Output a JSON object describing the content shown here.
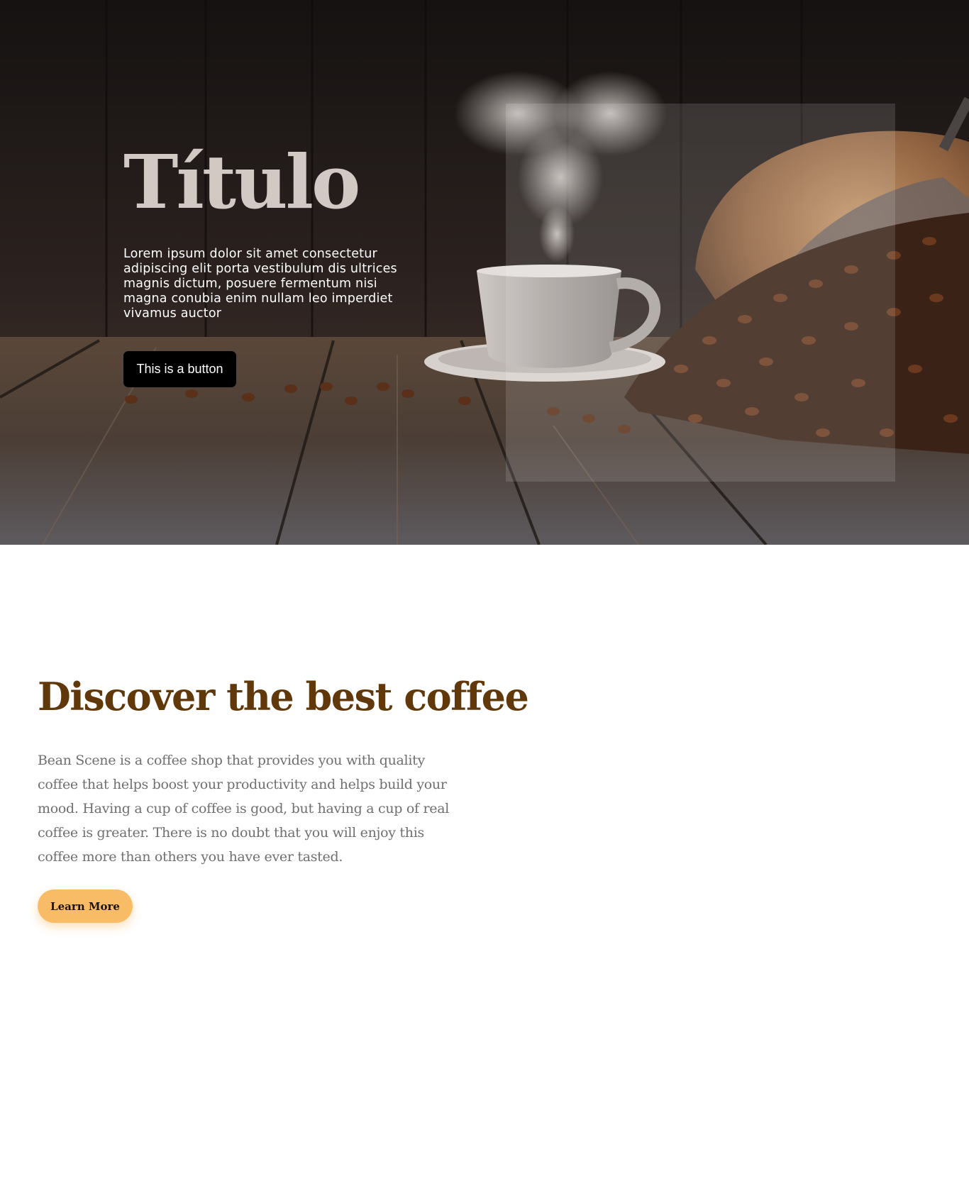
{
  "hero": {
    "title": "Título",
    "text": "Lorem ipsum dolor sit amet consectetur adipiscing elit porta vestibulum dis ultrices magnis dictum, posuere fermentum nisi magna conubia enim nullam leo imperdiet vivamus auctor",
    "button_label": "This is a button",
    "background_image": "coffee cup with heart-shaped steam, spilled coffee beans from burlap sack on wooden table"
  },
  "discover": {
    "title": "Discover the best coffee",
    "text": "Bean Scene is a coffee shop that provides you with quality coffee that helps boost your productivity and helps build your mood. Having a cup of coffee is good, but having a cup of real coffee is greater. There is no doubt that you will enjoy this coffee more than others you have ever tasted.",
    "button_label": "Learn More"
  },
  "colors": {
    "heading_brown": "#603809",
    "accent_orange": "#f8bc66",
    "hero_title": "#d2c8c4",
    "body_gray": "#6f6f6f"
  }
}
